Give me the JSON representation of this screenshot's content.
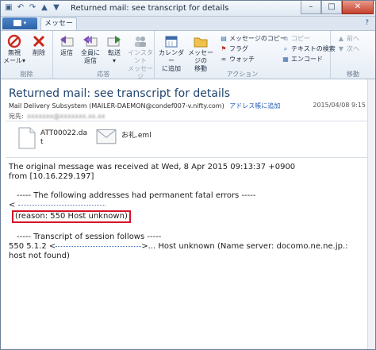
{
  "titlebar": {
    "title": "Returned mail: see transcript for details",
    "qat_icons": [
      "save-icon",
      "undo-icon",
      "redo-icon",
      "up-arrow-icon",
      "down-arrow-icon"
    ],
    "controls": [
      "minimize-icon",
      "maximize-icon",
      "close-icon"
    ]
  },
  "tabs": {
    "file_label": "",
    "message_label": "メッセージ"
  },
  "ribbon": {
    "groups": {
      "delete": "削除",
      "respond": "応答",
      "actions": "アクション",
      "move": "移動"
    },
    "buttons": {
      "ignore": "無視\nメール▾",
      "delete": "削除",
      "reply": "返信",
      "reply_all": "全員に\n返信",
      "forward": "転送\n▾",
      "im": "インスタント\nメッセージ",
      "calendar": "カレンダー\nに追加",
      "move_msg": "メッセージの\n移動"
    },
    "small_actions": {
      "copy_msg": "メッセージのコピー",
      "flag": "フラグ",
      "watch": "ウォッチ",
      "copy": "コピー",
      "text_search": "テキストの検索",
      "encode": "エンコード",
      "prev": "前へ",
      "next": "次へ"
    }
  },
  "message": {
    "subject": "Returned mail: see transcript for details",
    "sender_name": "Mail Delivery Subsystem",
    "sender_addr": "(MAILER-DAEMON@condef007-v.nifty.com)",
    "add_contact": "アドレス帳に追加",
    "date": "2015/04/08 9:15",
    "to_label": "宛先:",
    "to_value": "xxxxxxx@xxxxxxx.xx.xx",
    "attachments": [
      {
        "name": "ATT00022.da\nt"
      },
      {
        "name": "お礼.eml"
      }
    ]
  },
  "body": {
    "line1": "The original message was received at Wed, 8 Apr 2015 09:13:37 +0900",
    "line2": "from [10.16.229.197]",
    "line3": "----- The following addresses had permanent fatal errors -----",
    "line4_prefix": "<",
    "line5": "(reason: 550 Host unknown)",
    "line6": "----- Transcript of session follows -----",
    "line7_prefix": "550 5.1.2 <",
    "line7_suffix": ">... Host unknown (Name server: docomo.ne.ne.jp.: host not found)"
  }
}
